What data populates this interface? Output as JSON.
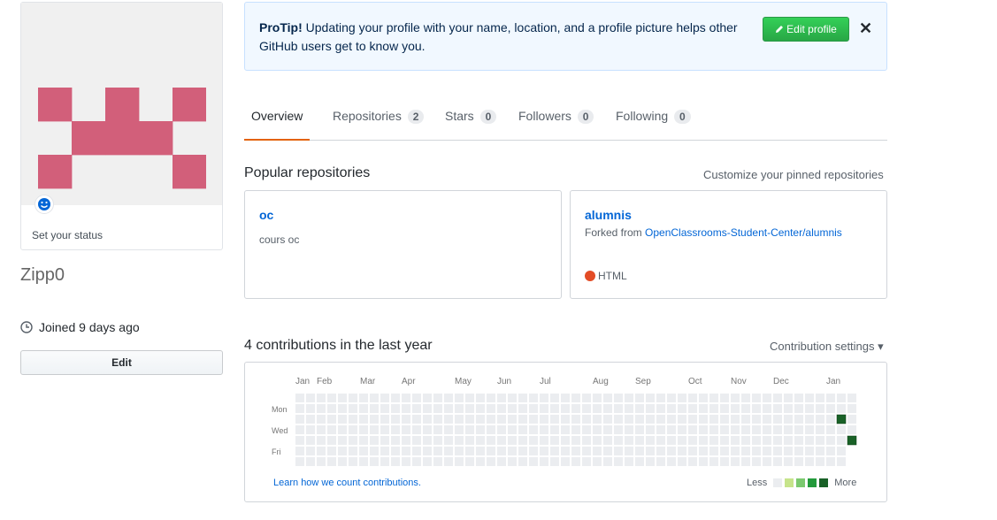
{
  "profile": {
    "status_text": "Set your status",
    "username": "Zipp0",
    "joined": "Joined 9 days ago",
    "edit_label": "Edit",
    "avatar_color": "#d25f7a"
  },
  "protip": {
    "bold": "ProTip!",
    "text": " Updating your profile with your name, location, and a profile picture helps other GitHub users get to know you.",
    "button_label": "Edit profile",
    "close_label": "✕"
  },
  "tabs": [
    {
      "label": "Overview",
      "count": null,
      "active": true
    },
    {
      "label": "Repositories",
      "count": "2",
      "active": false
    },
    {
      "label": "Stars",
      "count": "0",
      "active": false
    },
    {
      "label": "Followers",
      "count": "0",
      "active": false
    },
    {
      "label": "Following",
      "count": "0",
      "active": false
    }
  ],
  "popular": {
    "title": "Popular repositories",
    "customize": "Customize your pinned repositories",
    "repos": [
      {
        "name": "oc",
        "description": "cours oc"
      },
      {
        "name": "alumnis",
        "fork_prefix": "Forked from ",
        "fork_source": "OpenClassrooms-Student-Center/alumnis",
        "language": "HTML",
        "language_color": "#e34c26"
      }
    ]
  },
  "contributions": {
    "title": "4 contributions in the last year",
    "settings_label": "Contribution settings ▾",
    "months": [
      "Jan",
      "Feb",
      "Mar",
      "Apr",
      "May",
      "Jun",
      "Jul",
      "Aug",
      "Sep",
      "Oct",
      "Nov",
      "Dec",
      "Jan"
    ],
    "days": [
      "Mon",
      "Wed",
      "Fri"
    ],
    "learn_link": "Learn how we count contributions.",
    "legend_less": "Less",
    "legend_more": "More",
    "colors": [
      "#ebedf0",
      "#c6e48b",
      "#7bc96f",
      "#239a3b",
      "#196127"
    ],
    "active_cells": [
      {
        "week": 51,
        "day": 2,
        "level": 4
      },
      {
        "week": 52,
        "day": 4,
        "level": 4
      }
    ]
  }
}
